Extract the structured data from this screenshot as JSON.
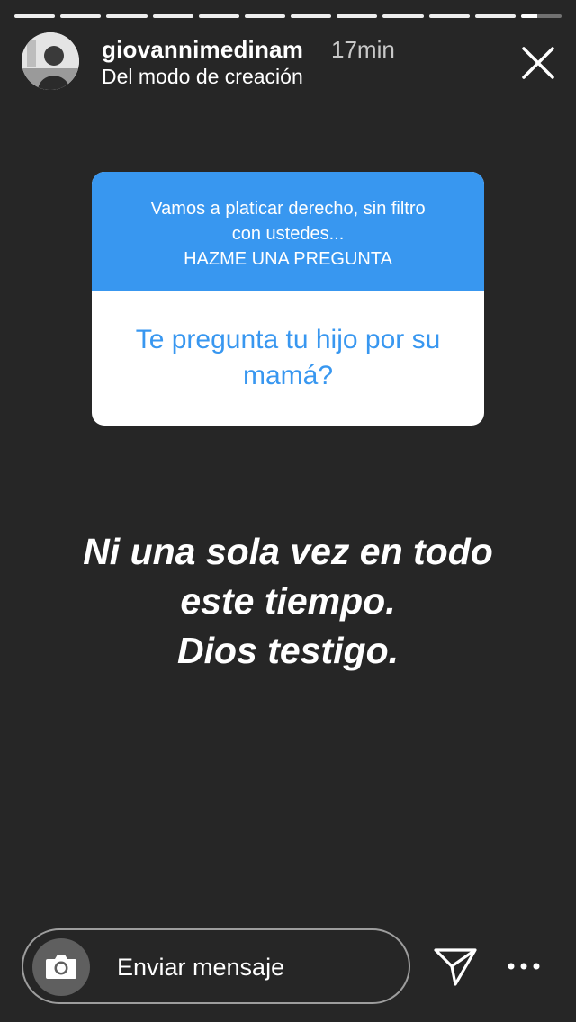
{
  "progress": {
    "segments_total": 12,
    "completed_segments": 11,
    "current_segment_progress": 0.4
  },
  "header": {
    "username": "giovannimedinam",
    "time": "17min",
    "subtitle": "Del modo de creación",
    "avatar_icon": "user-photo-icon",
    "close_icon": "close-icon"
  },
  "question_sticker": {
    "prompt_lines": [
      "Vamos a platicar derecho, sin filtro",
      "con ustedes...",
      "HAZME UNA PREGUNTA"
    ],
    "question": "Te pregunta tu hijo por su mamá?",
    "accent_color": "#3897f0"
  },
  "answer": {
    "lines": [
      "Ni una sola vez en todo",
      "este tiempo.",
      "Dios testigo."
    ]
  },
  "bottom_bar": {
    "camera_icon": "camera-icon",
    "message_placeholder": "Enviar mensaje",
    "send_icon": "send-icon",
    "more_icon": "more-options-icon"
  },
  "colors": {
    "background": "#262626",
    "text": "#ffffff",
    "sticker_blue": "#3897f0"
  }
}
